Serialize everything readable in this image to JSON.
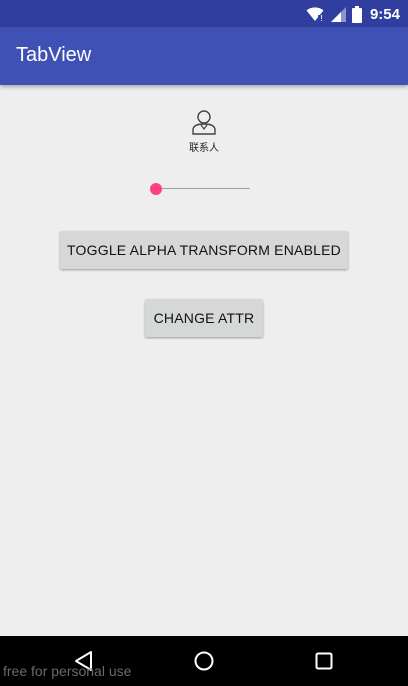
{
  "status_bar": {
    "time": "9:54",
    "icons": [
      "wifi-icon",
      "signal-icon",
      "battery-icon"
    ]
  },
  "app_bar": {
    "title": "TabView"
  },
  "tab": {
    "icon": "person-icon",
    "label": "联系人"
  },
  "slider": {
    "value": 0
  },
  "buttons": {
    "toggle_label": "TOGGLE ALPHA TRANSFORM ENABLED",
    "change_label": "CHANGE ATTR"
  },
  "nav_bar": {
    "icons": [
      "back-icon",
      "home-icon",
      "recents-icon"
    ]
  },
  "watermark": "free for personal use",
  "colors": {
    "status_bar": "#303f9f",
    "primary": "#3f51b5",
    "accent": "#ff4081",
    "background": "#eeeeee",
    "button": "#d6d7d7"
  }
}
